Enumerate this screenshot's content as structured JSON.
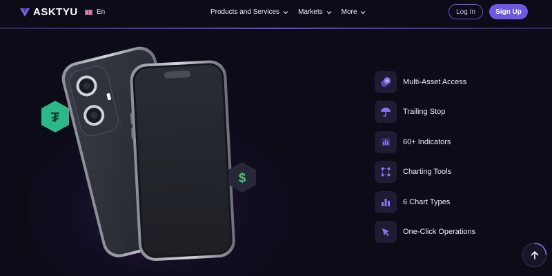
{
  "header": {
    "logo_text": "ASKTYU",
    "language": "En",
    "nav": [
      {
        "label": "Products and Services"
      },
      {
        "label": "Markets"
      },
      {
        "label": "More"
      }
    ],
    "login_label": "Log In",
    "signup_label": "Sign Up"
  },
  "hero": {
    "coins": [
      {
        "icon": "tether-icon",
        "symbol": "₮",
        "color": "#2bb88a"
      },
      {
        "icon": "dollar-icon",
        "symbol": "$",
        "color": "#4cc470"
      }
    ]
  },
  "features": [
    {
      "label": "Multi-Asset Access",
      "icon": "assets-icon"
    },
    {
      "label": "Trailing Stop",
      "icon": "umbrella-icon"
    },
    {
      "label": "60+ Indicators",
      "icon": "indicators-icon"
    },
    {
      "label": "Charting Tools",
      "icon": "charting-tools-icon"
    },
    {
      "label": "6 Chart Types",
      "icon": "bar-chart-icon"
    },
    {
      "label": "One-Click Operations",
      "icon": "cursor-click-icon"
    }
  ],
  "colors": {
    "background": "#0d0b18",
    "accent": "#6e56e6",
    "icon_purple": "#8a72f0"
  }
}
